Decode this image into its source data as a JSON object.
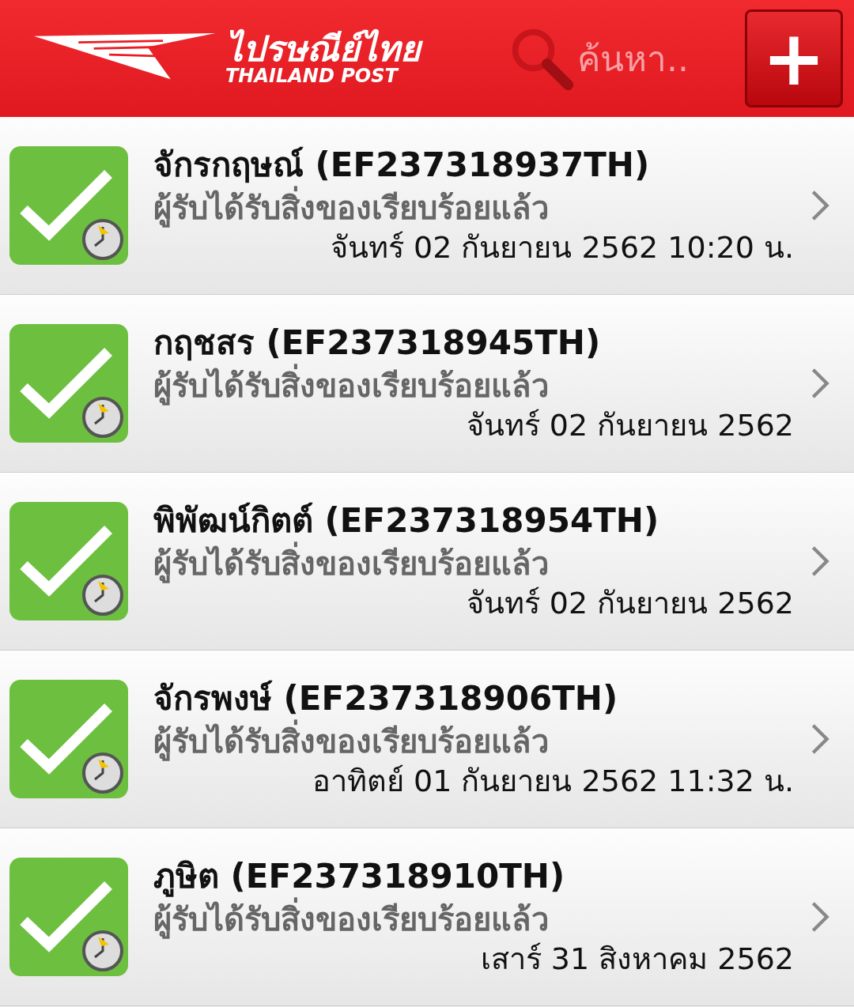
{
  "header": {
    "logo_thai": "ไปรษณีย์ไทย",
    "logo_english": "THAILAND POST",
    "search": {
      "placeholder": "ค้นหา.."
    },
    "add_button": "+"
  },
  "items": [
    {
      "title": "จักรกฤษณ์ (EF237318937TH)",
      "status": "ผู้รับได้รับสิ่งของเรียบร้อยแล้ว",
      "date": "จันทร์ 02 กันยายน 2562 10:20 น."
    },
    {
      "title": "กฤชสร (EF237318945TH)",
      "status": "ผู้รับได้รับสิ่งของเรียบร้อยแล้ว",
      "date": "จันทร์ 02 กันยายน 2562"
    },
    {
      "title": "พิพัฒน์กิตต์ (EF237318954TH)",
      "status": "ผู้รับได้รับสิ่งของเรียบร้อยแล้ว",
      "date": "จันทร์ 02 กันยายน 2562"
    },
    {
      "title": "จักรพงษ์ (EF237318906TH)",
      "status": "ผู้รับได้รับสิ่งของเรียบร้อยแล้ว",
      "date": "อาทิตย์ 01 กันยายน 2562 11:32 น."
    },
    {
      "title": "ภูษิต (EF237318910TH)",
      "status": "ผู้รับได้รับสิ่งของเรียบร้อยแล้ว",
      "date": "เสาร์ 31 สิงหาคม 2562"
    }
  ]
}
